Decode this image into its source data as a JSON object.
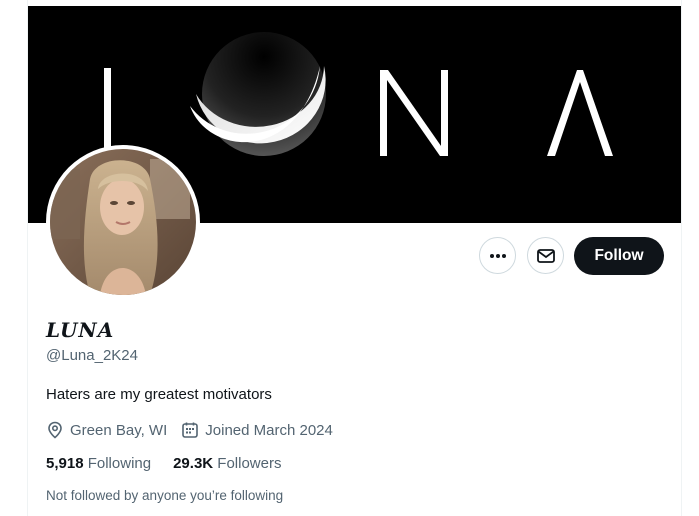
{
  "profile": {
    "banner_text": "LUNA",
    "display_name": "LUNA",
    "handle": "@Luna_2K24",
    "bio": "Haters are my greatest motivators",
    "location": "Green Bay, WI",
    "joined": "Joined March 2024",
    "following_count": "5,918",
    "following_label": "Following",
    "followers_count": "29.3K",
    "followers_label": "Followers",
    "followed_by_note": "Not followed by anyone you’re following"
  },
  "actions": {
    "follow_label": "Follow",
    "more_icon": "more-icon",
    "message_icon": "envelope-icon"
  },
  "colors": {
    "primary_text": "#0f1419",
    "secondary_text": "#536471",
    "follow_bg": "#0f1419",
    "banner_bg": "#000000"
  }
}
